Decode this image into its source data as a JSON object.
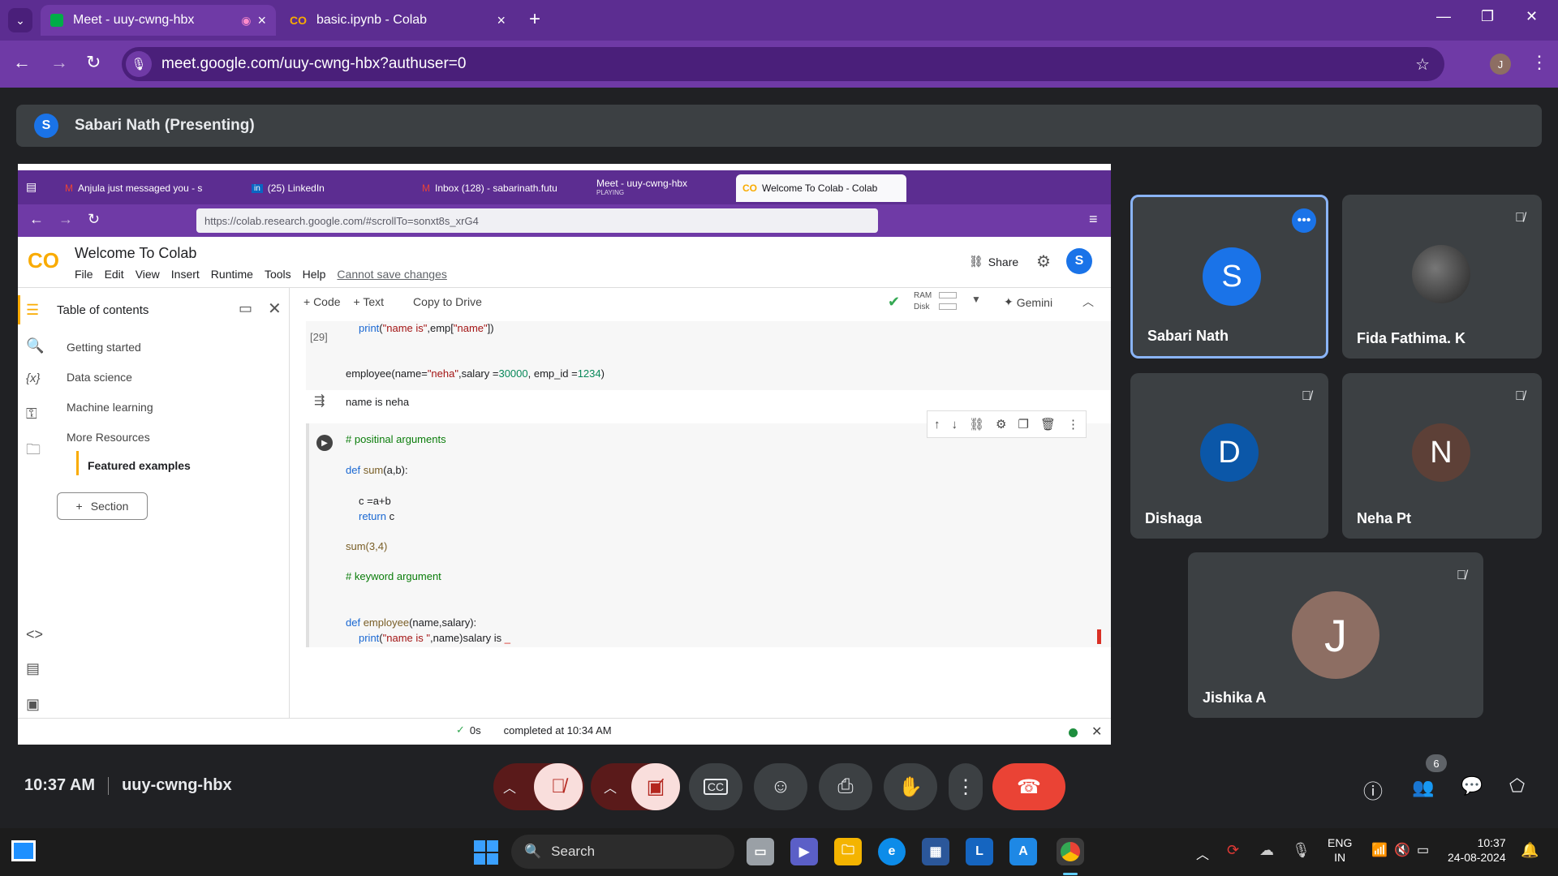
{
  "browser": {
    "tabs": [
      {
        "title": "Meet - uuy-cwng-hbx",
        "active": true
      },
      {
        "title": "basic.ipynb - Colab",
        "active": false
      }
    ],
    "url": "meet.google.com/uuy-cwng-hbx?authuser=0",
    "profile_initial": "J"
  },
  "presenting": {
    "initial": "S",
    "label": "Sabari Nath (Presenting)"
  },
  "shared": {
    "tabs": [
      "Anjula just messaged you - s",
      "(25) LinkedIn",
      "Inbox (128) - sabarinath.futu",
      "Meet - uuy-cwng-hbx",
      "Welcome To Colab - Colab"
    ],
    "tab_sub": "PLAYING",
    "url": "https://colab.research.google.com/#scrollTo=sonxt8s_xrG4",
    "colab": {
      "title": "Welcome To Colab",
      "menu": [
        "File",
        "Edit",
        "View",
        "Insert",
        "Runtime",
        "Tools",
        "Help"
      ],
      "cannot_save": "Cannot save changes",
      "share": "Share",
      "avatar": "S",
      "toolbar": {
        "code": "+ Code",
        "text": "+ Text",
        "copy": "Copy to Drive",
        "ram": "RAM",
        "disk": "Disk",
        "gemini": "Gemini"
      },
      "toc": {
        "title": "Table of contents",
        "items": [
          "Getting started",
          "Data science",
          "Machine learning",
          "More Resources",
          "Featured examples"
        ],
        "section": "Section"
      },
      "cell_prev": {
        "exec": "[29]",
        "line1": "print(\"name is\",emp[\"name\"])",
        "line2": "employee(name=\"neha\",salary =30000, emp_id =1234)",
        "output": "name is neha"
      },
      "cell_cur": {
        "lines": [
          "# positinal arguments",
          "def sum(a,b):",
          "c =a+b",
          "return c",
          "sum(3,4)",
          "# keyword argument",
          "def employee(name,salary):",
          "print(\"name is \",name)salary is _"
        ]
      },
      "status": {
        "check": "0s",
        "text": "completed at 10:34 AM"
      }
    }
  },
  "participants": [
    {
      "name": "Sabari Nath",
      "initial": "S",
      "color": "#1a73e8",
      "muted": false
    },
    {
      "name": "Fida Fathima. K",
      "initial": "",
      "color": "#555",
      "muted": true
    },
    {
      "name": "Dishaga",
      "initial": "D",
      "color": "#0b57a8",
      "muted": true
    },
    {
      "name": "Neha Pt",
      "initial": "N",
      "color": "#5d4037",
      "muted": true
    },
    {
      "name": "Jishika A",
      "initial": "J",
      "color": "#8d6e63",
      "muted": true
    }
  ],
  "meeting": {
    "time": "10:37 AM",
    "code": "uuy-cwng-hbx",
    "participants_count": "6"
  },
  "taskbar": {
    "search": "Search",
    "lang": "ENG",
    "region": "IN",
    "time": "10:37",
    "date": "24-08-2024"
  }
}
